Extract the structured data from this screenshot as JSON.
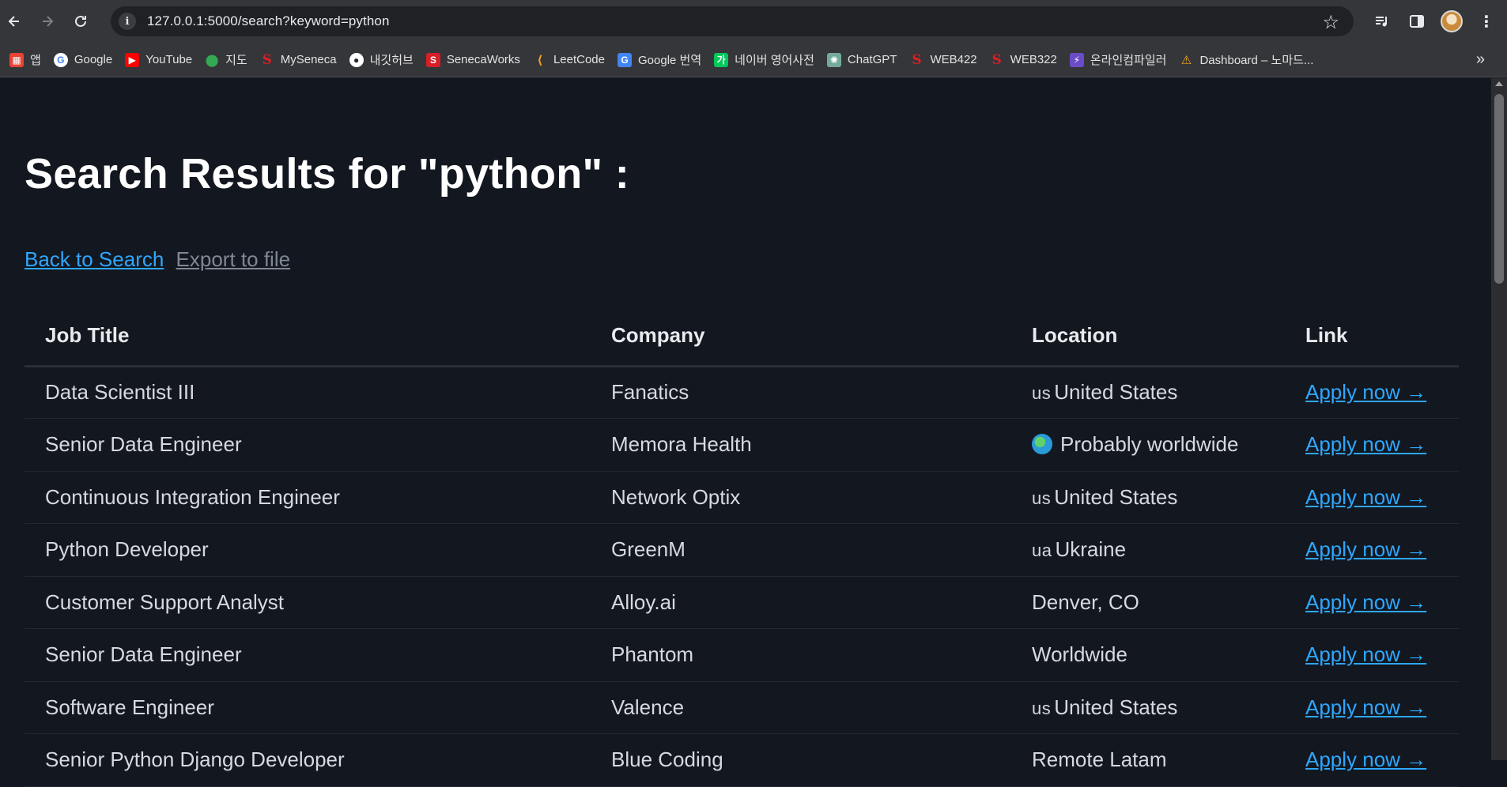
{
  "browser": {
    "url": "127.0.0.1:5000/search?keyword=python",
    "bookmarks": [
      {
        "label": "앱",
        "icon": "apps-grid-icon",
        "color": "#ea4335"
      },
      {
        "label": "Google",
        "icon": "google-icon",
        "color": "#4285f4"
      },
      {
        "label": "YouTube",
        "icon": "youtube-icon",
        "color": "#ff0000"
      },
      {
        "label": "지도",
        "icon": "maps-pin-icon",
        "color": "#34a853"
      },
      {
        "label": "MySeneca",
        "icon": "seneca-icon",
        "color": "#d81f26"
      },
      {
        "label": "내깃허브",
        "icon": "github-icon",
        "color": "#24292f"
      },
      {
        "label": "SenecaWorks",
        "icon": "seneca-square-icon",
        "color": "#d81f26"
      },
      {
        "label": "LeetCode",
        "icon": "leetcode-icon",
        "color": "#ffa116"
      },
      {
        "label": "Google 번역",
        "icon": "google-translate-icon",
        "color": "#4285f4"
      },
      {
        "label": "네이버 영어사전",
        "icon": "naver-dict-icon",
        "color": "#03c75a"
      },
      {
        "label": "ChatGPT",
        "icon": "chatgpt-icon",
        "color": "#74aa9c"
      },
      {
        "label": "WEB422",
        "icon": "seneca-icon",
        "color": "#d81f26"
      },
      {
        "label": "WEB322",
        "icon": "seneca-icon",
        "color": "#d81f26"
      },
      {
        "label": "온라인컴파일러",
        "icon": "bolt-icon",
        "color": "#6a4cc7"
      },
      {
        "label": "Dashboard – 노마드...",
        "icon": "nomad-warning-icon",
        "color": "#f5a623"
      }
    ]
  },
  "page": {
    "title": "Search Results for \"python\" :",
    "back_link": "Back to Search",
    "export_link": "Export to file",
    "columns": [
      "Job Title",
      "Company",
      "Location",
      "Link"
    ],
    "rows": [
      {
        "title": "Data Scientist III",
        "company": "Fanatics",
        "flag": "us",
        "location": "United States",
        "link": "Apply now →"
      },
      {
        "title": "Senior Data Engineer",
        "company": "Memora Health",
        "flag": "globe",
        "location": "Probably worldwide",
        "link": "Apply now →"
      },
      {
        "title": "Continuous Integration Engineer",
        "company": "Network Optix",
        "flag": "us",
        "location": "United States",
        "link": "Apply now →"
      },
      {
        "title": "Python Developer",
        "company": "GreenM",
        "flag": "ua",
        "location": "Ukraine",
        "link": "Apply now →"
      },
      {
        "title": "Customer Support Analyst",
        "company": "Alloy.ai",
        "flag": "",
        "location": "Denver, CO",
        "link": "Apply now →"
      },
      {
        "title": "Senior Data Engineer",
        "company": "Phantom",
        "flag": "",
        "location": "Worldwide",
        "link": "Apply now →"
      },
      {
        "title": "Software Engineer",
        "company": "Valence",
        "flag": "us",
        "location": "United States",
        "link": "Apply now →"
      },
      {
        "title": "Senior Python Django Developer",
        "company": "Blue Coding",
        "flag": "",
        "location": "Remote Latam",
        "link": "Apply now →"
      }
    ]
  }
}
